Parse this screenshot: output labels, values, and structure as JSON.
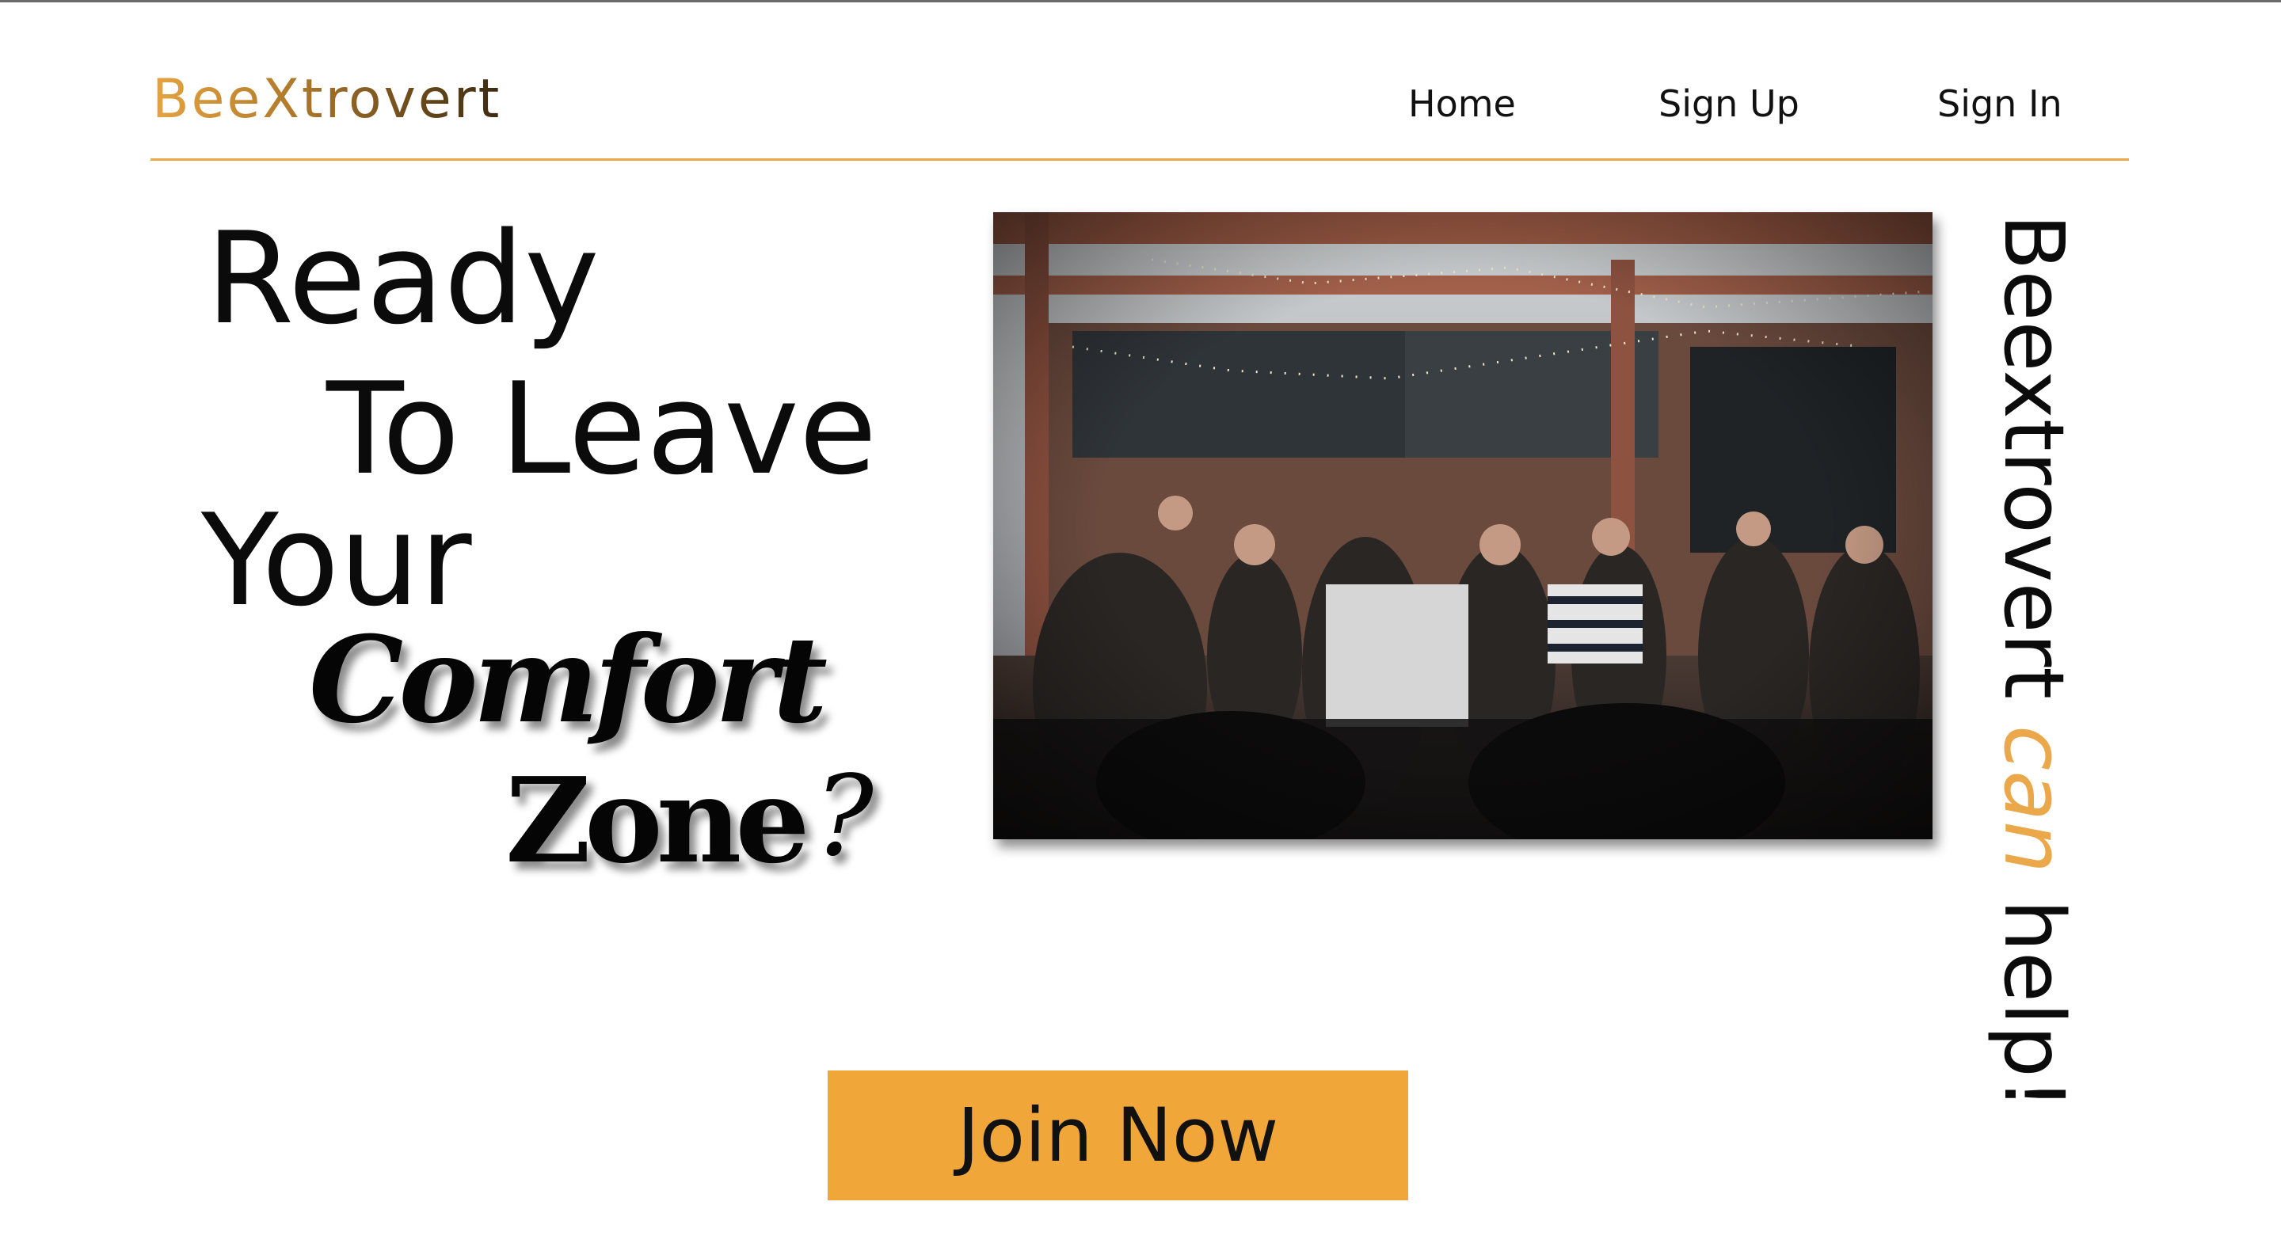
{
  "brand": {
    "logo_text": "BeeXtrovert"
  },
  "nav": {
    "home": "Home",
    "sign_up": "Sign Up",
    "sign_in": "Sign In"
  },
  "hero": {
    "line1": "Ready",
    "line2": "To Leave",
    "line3": "Your",
    "line4": "Comfort",
    "line5": "Zone",
    "punctuation": "?",
    "tagline_part1": "Beextrovert ",
    "tagline_accent": "can",
    "tagline_part2": " help!",
    "photo_icon": "party-crowd-photo",
    "cta_label": "Join Now"
  },
  "colors": {
    "accent": "#f0a638",
    "rule": "#eba84a",
    "text": "#111111"
  }
}
